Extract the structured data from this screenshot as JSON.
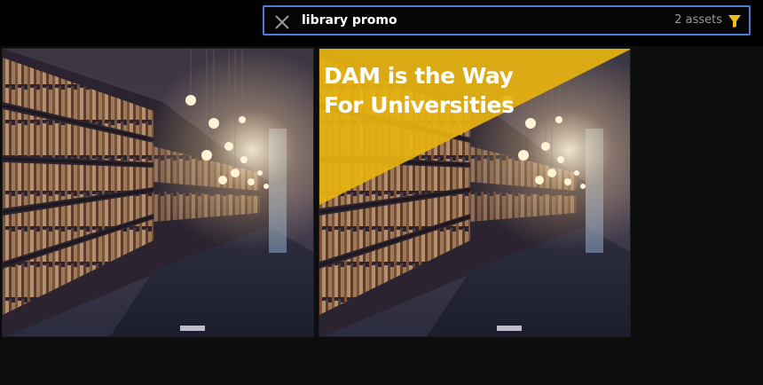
{
  "search": {
    "query": "library promo",
    "result_count": "2 assets",
    "accent_color": "#4a7fd6",
    "filter_color": "#f2c014"
  },
  "results": [
    {
      "icon": "library-photo",
      "overlay": null
    },
    {
      "icon": "library-photo",
      "overlay": {
        "line1": "DAM is the Way",
        "line2": "For Universities",
        "color": "#e6b310"
      }
    }
  ]
}
